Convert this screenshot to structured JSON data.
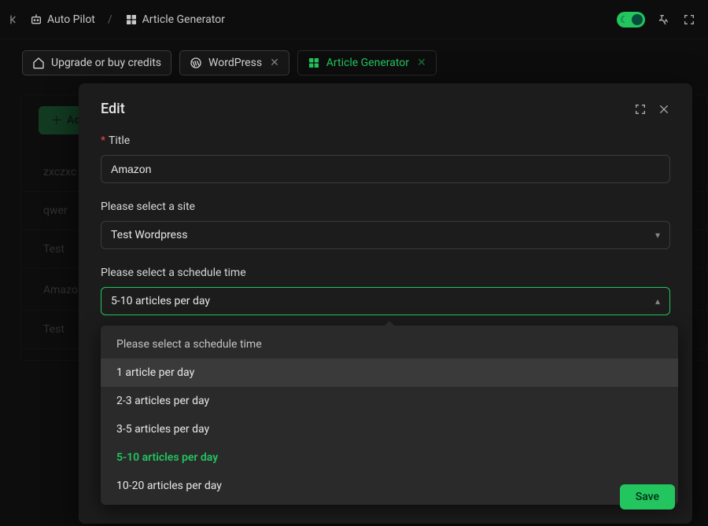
{
  "breadcrumb": {
    "root": "Auto Pilot",
    "section": "Article Generator"
  },
  "tabs": {
    "upgrade": "Upgrade or buy credits",
    "wordpress": "WordPress",
    "article_generator": "Article Generator"
  },
  "bg": {
    "add": "Add",
    "rows": [
      "zxczxc",
      "qwer",
      "Test",
      "Amazon 码产",
      "Test"
    ]
  },
  "modal": {
    "title": "Edit",
    "field_title_label": "Title",
    "field_title_value": "Amazon",
    "field_site_label": "Please select a site",
    "field_site_value": "Test Wordpress",
    "field_schedule_label": "Please select a schedule time",
    "field_schedule_value": "5-10 articles per day",
    "save": "Save"
  },
  "dropdown": {
    "placeholder": "Please select a schedule time",
    "options": [
      "1 article per day",
      "2-3 articles per day",
      "3-5 articles per day",
      "5-10 articles per day",
      "10-20 articles per day"
    ],
    "selected": "5-10 articles per day",
    "hovered": "1 article per day"
  }
}
